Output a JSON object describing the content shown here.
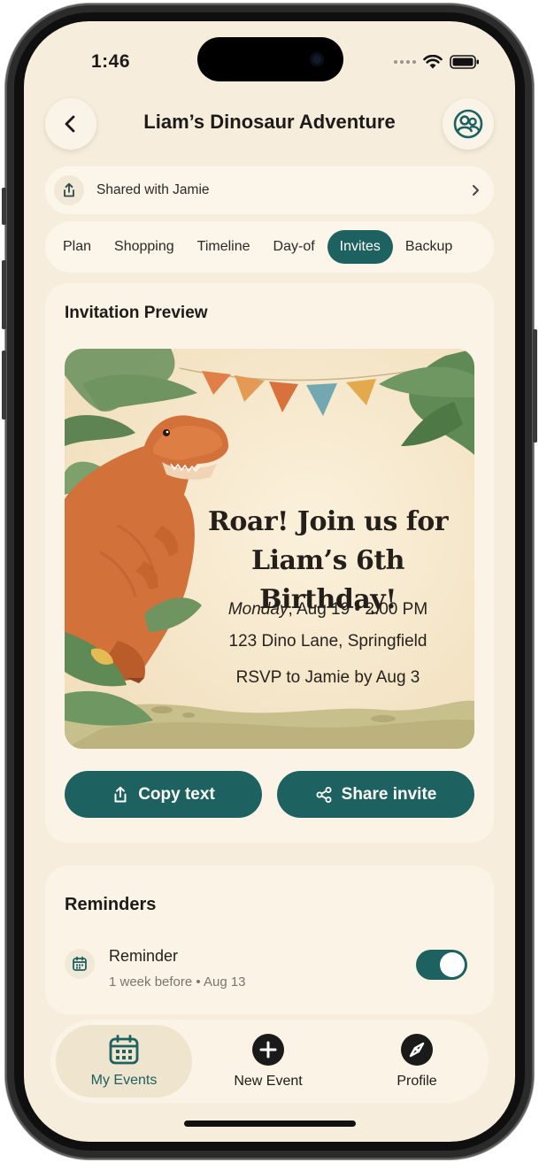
{
  "status_bar": {
    "time": "1:46"
  },
  "header": {
    "title": "Liam’s Dinosaur Adventure"
  },
  "shared": {
    "label": "Shared with Jamie"
  },
  "tabs": [
    {
      "label": "Plan"
    },
    {
      "label": "Shopping"
    },
    {
      "label": "Timeline"
    },
    {
      "label": "Day-of"
    },
    {
      "label": "Invites"
    },
    {
      "label": "Backup"
    }
  ],
  "active_tab": "Invites",
  "invitation": {
    "section_title": "Invitation Preview",
    "headline_line1": "Roar! Join us for",
    "headline_line2": "Liam’s 6th Birthday!",
    "day": "Monday",
    "date_time": ", Aug 19 • 2:00 PM",
    "address": "123 Dino Lane, Springfield",
    "rsvp": "RSVP to Jamie by Aug 3",
    "copy_button": "Copy text",
    "share_button": "Share invite"
  },
  "reminders": {
    "section_title": "Reminders",
    "items": [
      {
        "label": "Reminder",
        "detail": "1 week before • Aug 13",
        "enabled": true
      }
    ]
  },
  "bottom_nav": [
    {
      "label": "My Events",
      "icon": "calendar-icon",
      "active": true
    },
    {
      "label": "New Event",
      "icon": "plus-circle-icon",
      "active": false
    },
    {
      "label": "Profile",
      "icon": "compass-icon",
      "active": false
    }
  ],
  "colors": {
    "accent": "#1d6160",
    "background": "#f6eddc",
    "card": "#fbf4e6"
  }
}
